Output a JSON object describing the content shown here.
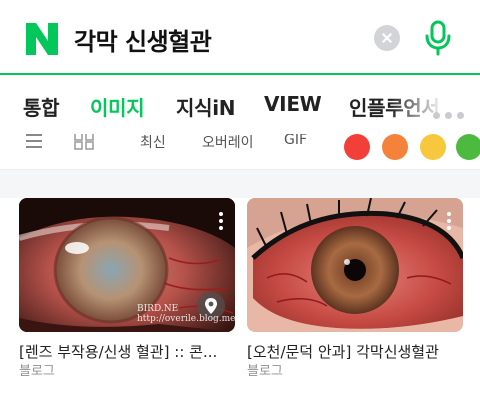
{
  "search": {
    "query": "각막 신생혈관",
    "brand_color": "#03c75a"
  },
  "tabs": [
    {
      "label": "통합",
      "active": false
    },
    {
      "label": "이미지",
      "active": true
    },
    {
      "label": "지식iN",
      "active": false
    },
    {
      "label": "VIEW",
      "active": false
    },
    {
      "label": "인플루언서",
      "active": false
    }
  ],
  "filters": {
    "chips": [
      "최신",
      "오버레이",
      "GIF"
    ],
    "color_swatches": [
      "#f23f37",
      "#f5823a",
      "#f7c83d",
      "#4cb93f"
    ]
  },
  "results": [
    {
      "title": "[렌즈 부작용/신생 혈관] :: 콘...",
      "source": "블로그",
      "watermark_line1": "BIRD.NE",
      "watermark_line2": "http://overile.blog.me/"
    },
    {
      "title": "[오천/문덕 안과] 각막신생혈관",
      "source": "블로그"
    }
  ]
}
